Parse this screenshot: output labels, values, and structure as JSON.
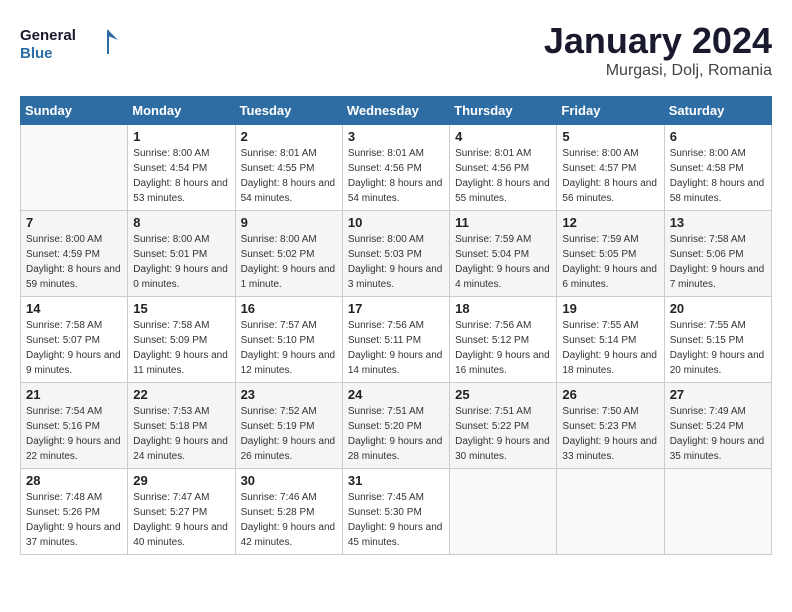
{
  "logo": {
    "line1": "General",
    "line2": "Blue"
  },
  "title": "January 2024",
  "subtitle": "Murgasi, Dolj, Romania",
  "days_of_week": [
    "Sunday",
    "Monday",
    "Tuesday",
    "Wednesday",
    "Thursday",
    "Friday",
    "Saturday"
  ],
  "weeks": [
    [
      {
        "day": "",
        "sunrise": "",
        "sunset": "",
        "daylight": ""
      },
      {
        "day": "1",
        "sunrise": "Sunrise: 8:00 AM",
        "sunset": "Sunset: 4:54 PM",
        "daylight": "Daylight: 8 hours and 53 minutes."
      },
      {
        "day": "2",
        "sunrise": "Sunrise: 8:01 AM",
        "sunset": "Sunset: 4:55 PM",
        "daylight": "Daylight: 8 hours and 54 minutes."
      },
      {
        "day": "3",
        "sunrise": "Sunrise: 8:01 AM",
        "sunset": "Sunset: 4:56 PM",
        "daylight": "Daylight: 8 hours and 54 minutes."
      },
      {
        "day": "4",
        "sunrise": "Sunrise: 8:01 AM",
        "sunset": "Sunset: 4:56 PM",
        "daylight": "Daylight: 8 hours and 55 minutes."
      },
      {
        "day": "5",
        "sunrise": "Sunrise: 8:00 AM",
        "sunset": "Sunset: 4:57 PM",
        "daylight": "Daylight: 8 hours and 56 minutes."
      },
      {
        "day": "6",
        "sunrise": "Sunrise: 8:00 AM",
        "sunset": "Sunset: 4:58 PM",
        "daylight": "Daylight: 8 hours and 58 minutes."
      }
    ],
    [
      {
        "day": "7",
        "sunrise": "Sunrise: 8:00 AM",
        "sunset": "Sunset: 4:59 PM",
        "daylight": "Daylight: 8 hours and 59 minutes."
      },
      {
        "day": "8",
        "sunrise": "Sunrise: 8:00 AM",
        "sunset": "Sunset: 5:01 PM",
        "daylight": "Daylight: 9 hours and 0 minutes."
      },
      {
        "day": "9",
        "sunrise": "Sunrise: 8:00 AM",
        "sunset": "Sunset: 5:02 PM",
        "daylight": "Daylight: 9 hours and 1 minute."
      },
      {
        "day": "10",
        "sunrise": "Sunrise: 8:00 AM",
        "sunset": "Sunset: 5:03 PM",
        "daylight": "Daylight: 9 hours and 3 minutes."
      },
      {
        "day": "11",
        "sunrise": "Sunrise: 7:59 AM",
        "sunset": "Sunset: 5:04 PM",
        "daylight": "Daylight: 9 hours and 4 minutes."
      },
      {
        "day": "12",
        "sunrise": "Sunrise: 7:59 AM",
        "sunset": "Sunset: 5:05 PM",
        "daylight": "Daylight: 9 hours and 6 minutes."
      },
      {
        "day": "13",
        "sunrise": "Sunrise: 7:58 AM",
        "sunset": "Sunset: 5:06 PM",
        "daylight": "Daylight: 9 hours and 7 minutes."
      }
    ],
    [
      {
        "day": "14",
        "sunrise": "Sunrise: 7:58 AM",
        "sunset": "Sunset: 5:07 PM",
        "daylight": "Daylight: 9 hours and 9 minutes."
      },
      {
        "day": "15",
        "sunrise": "Sunrise: 7:58 AM",
        "sunset": "Sunset: 5:09 PM",
        "daylight": "Daylight: 9 hours and 11 minutes."
      },
      {
        "day": "16",
        "sunrise": "Sunrise: 7:57 AM",
        "sunset": "Sunset: 5:10 PM",
        "daylight": "Daylight: 9 hours and 12 minutes."
      },
      {
        "day": "17",
        "sunrise": "Sunrise: 7:56 AM",
        "sunset": "Sunset: 5:11 PM",
        "daylight": "Daylight: 9 hours and 14 minutes."
      },
      {
        "day": "18",
        "sunrise": "Sunrise: 7:56 AM",
        "sunset": "Sunset: 5:12 PM",
        "daylight": "Daylight: 9 hours and 16 minutes."
      },
      {
        "day": "19",
        "sunrise": "Sunrise: 7:55 AM",
        "sunset": "Sunset: 5:14 PM",
        "daylight": "Daylight: 9 hours and 18 minutes."
      },
      {
        "day": "20",
        "sunrise": "Sunrise: 7:55 AM",
        "sunset": "Sunset: 5:15 PM",
        "daylight": "Daylight: 9 hours and 20 minutes."
      }
    ],
    [
      {
        "day": "21",
        "sunrise": "Sunrise: 7:54 AM",
        "sunset": "Sunset: 5:16 PM",
        "daylight": "Daylight: 9 hours and 22 minutes."
      },
      {
        "day": "22",
        "sunrise": "Sunrise: 7:53 AM",
        "sunset": "Sunset: 5:18 PM",
        "daylight": "Daylight: 9 hours and 24 minutes."
      },
      {
        "day": "23",
        "sunrise": "Sunrise: 7:52 AM",
        "sunset": "Sunset: 5:19 PM",
        "daylight": "Daylight: 9 hours and 26 minutes."
      },
      {
        "day": "24",
        "sunrise": "Sunrise: 7:51 AM",
        "sunset": "Sunset: 5:20 PM",
        "daylight": "Daylight: 9 hours and 28 minutes."
      },
      {
        "day": "25",
        "sunrise": "Sunrise: 7:51 AM",
        "sunset": "Sunset: 5:22 PM",
        "daylight": "Daylight: 9 hours and 30 minutes."
      },
      {
        "day": "26",
        "sunrise": "Sunrise: 7:50 AM",
        "sunset": "Sunset: 5:23 PM",
        "daylight": "Daylight: 9 hours and 33 minutes."
      },
      {
        "day": "27",
        "sunrise": "Sunrise: 7:49 AM",
        "sunset": "Sunset: 5:24 PM",
        "daylight": "Daylight: 9 hours and 35 minutes."
      }
    ],
    [
      {
        "day": "28",
        "sunrise": "Sunrise: 7:48 AM",
        "sunset": "Sunset: 5:26 PM",
        "daylight": "Daylight: 9 hours and 37 minutes."
      },
      {
        "day": "29",
        "sunrise": "Sunrise: 7:47 AM",
        "sunset": "Sunset: 5:27 PM",
        "daylight": "Daylight: 9 hours and 40 minutes."
      },
      {
        "day": "30",
        "sunrise": "Sunrise: 7:46 AM",
        "sunset": "Sunset: 5:28 PM",
        "daylight": "Daylight: 9 hours and 42 minutes."
      },
      {
        "day": "31",
        "sunrise": "Sunrise: 7:45 AM",
        "sunset": "Sunset: 5:30 PM",
        "daylight": "Daylight: 9 hours and 45 minutes."
      },
      {
        "day": "",
        "sunrise": "",
        "sunset": "",
        "daylight": ""
      },
      {
        "day": "",
        "sunrise": "",
        "sunset": "",
        "daylight": ""
      },
      {
        "day": "",
        "sunrise": "",
        "sunset": "",
        "daylight": ""
      }
    ]
  ]
}
